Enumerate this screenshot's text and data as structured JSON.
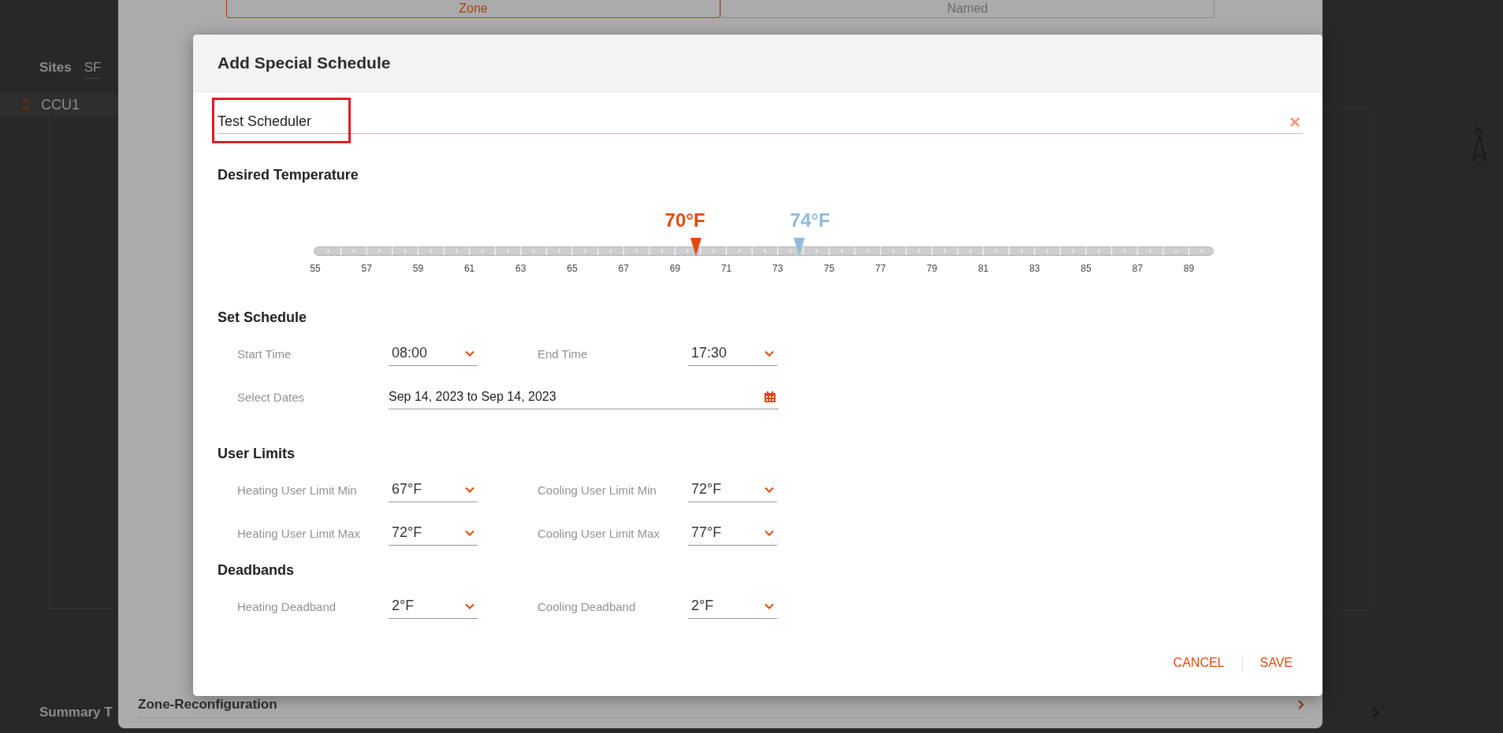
{
  "background": {
    "nav_tabs": [
      {
        "label": "Sites",
        "selected": true
      },
      {
        "label": "SF",
        "selected": false
      }
    ],
    "list_item": "CCU1",
    "footer_heading": "Summary T"
  },
  "panel": {
    "tabs": [
      {
        "label": "Zone",
        "selected": true
      },
      {
        "label": "Named",
        "selected": false
      }
    ],
    "section": "Zone-Reconfiguration"
  },
  "dialog": {
    "title": "Add Special Schedule",
    "name_field": {
      "value": "Test Scheduler",
      "highlighted": true
    },
    "desired_temperature": {
      "title": "Desired Temperature",
      "heating": {
        "reading": "70°F",
        "level": 0.425
      },
      "cooling": {
        "reading": "74°F",
        "level": 0.539
      },
      "scale": [
        "55",
        "57",
        "59",
        "61",
        "63",
        "65",
        "67",
        "69",
        "71",
        "73",
        "75",
        "77",
        "79",
        "81",
        "83",
        "85",
        "87",
        "89"
      ]
    },
    "sections": [
      {
        "title": "Set Schedule",
        "rows": [
          {
            "kind": "pair",
            "fields": [
              {
                "label": "Start Time",
                "value": "08:00"
              },
              {
                "label": "End Time",
                "value": "17:30"
              }
            ]
          },
          {
            "kind": "date",
            "label": "Select Dates",
            "value": "Sep 14, 2023 to Sep 14, 2023"
          }
        ]
      },
      {
        "title": "User Limits",
        "rows": [
          {
            "kind": "pair",
            "fields": [
              {
                "label": "Heating User Limit Min",
                "value": "67°F"
              },
              {
                "label": "Cooling User Limit Min",
                "value": "72°F"
              }
            ]
          },
          {
            "kind": "pair",
            "fields": [
              {
                "label": "Heating User Limit Max",
                "value": "72°F"
              },
              {
                "label": "Cooling User Limit Max",
                "value": "77°F"
              }
            ]
          }
        ]
      },
      {
        "title": "Deadbands",
        "rows": [
          {
            "kind": "pair",
            "fields": [
              {
                "label": "Heating Deadband",
                "value": "2°F"
              },
              {
                "label": "Cooling Deadband",
                "value": "2°F"
              }
            ]
          }
        ]
      }
    ],
    "buttons": [
      "CANCEL",
      "SAVE"
    ]
  }
}
